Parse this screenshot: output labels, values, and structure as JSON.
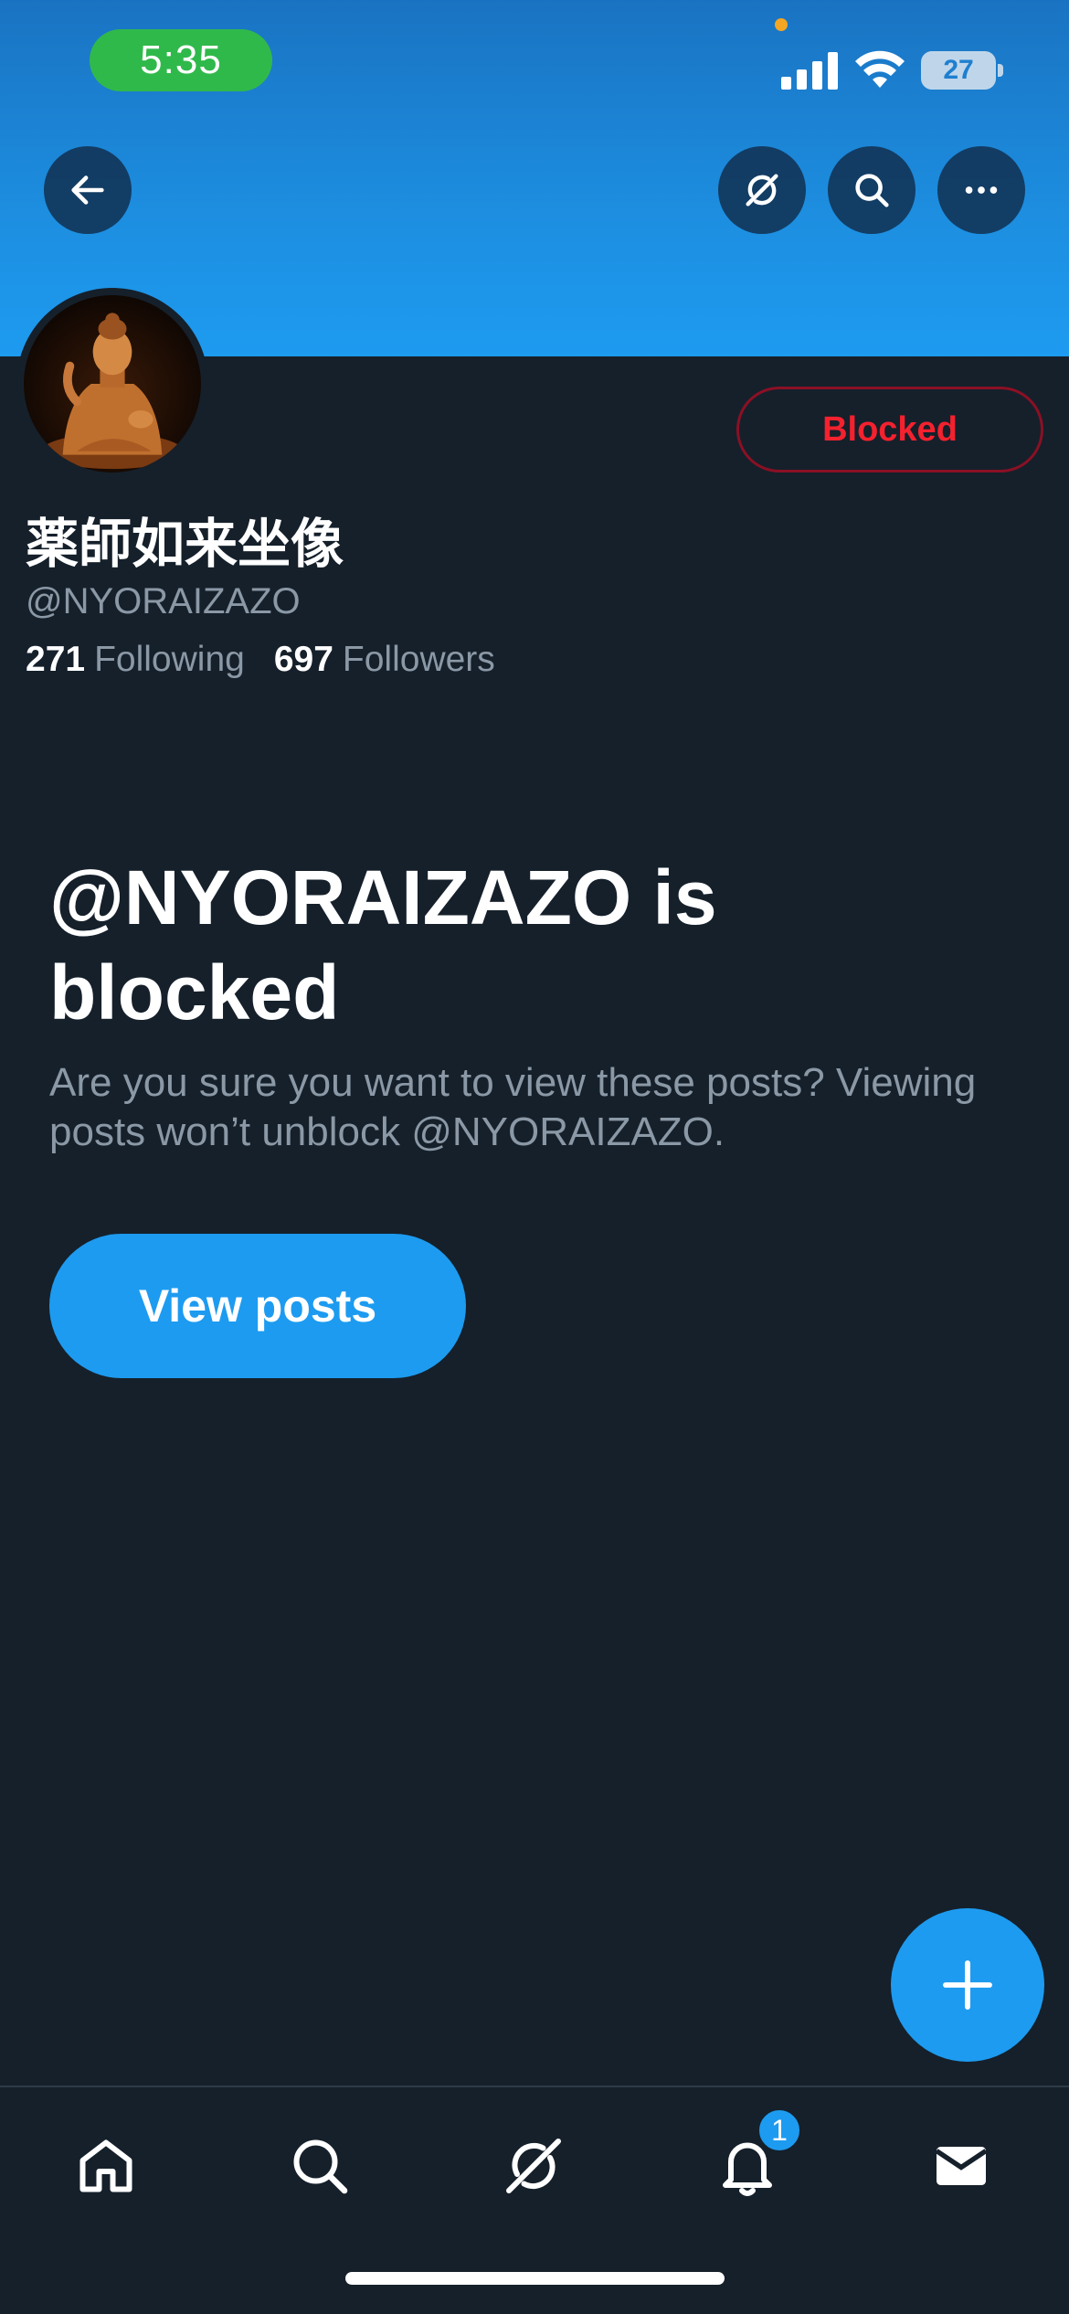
{
  "status_bar": {
    "time": "5:35",
    "battery": "27",
    "icons": [
      "signal-icon",
      "wifi-icon",
      "battery-icon"
    ]
  },
  "header": {
    "buttons": [
      "back-arrow-icon",
      "grok-icon",
      "search-icon",
      "more-icon"
    ]
  },
  "profile": {
    "display_name": "薬師如来坐像",
    "handle": "@NYORAIZAZO",
    "following_count": "271",
    "following_label": "Following",
    "followers_count": "697",
    "followers_label": "Followers",
    "blocked_label": "Blocked",
    "avatar": "buddha-statue-avatar"
  },
  "blocked_notice": {
    "title": "@NYORAIZAZO is blocked",
    "description": "Are you sure you want to view these posts? Viewing posts won’t unblock @NYORAIZAZO.",
    "button_label": "View posts"
  },
  "fab": {
    "icon": "plus-icon"
  },
  "bottom_nav": {
    "items": [
      "home-icon",
      "search-icon",
      "grok-icon",
      "notifications-icon",
      "messages-icon"
    ],
    "notification_badge": "1"
  },
  "colors": {
    "background": "#15202b",
    "accent": "#1d9bf0",
    "blocked_red": "#f4212e",
    "secondary_text": "#8b98a5",
    "status_time_green": "#30b94b"
  }
}
